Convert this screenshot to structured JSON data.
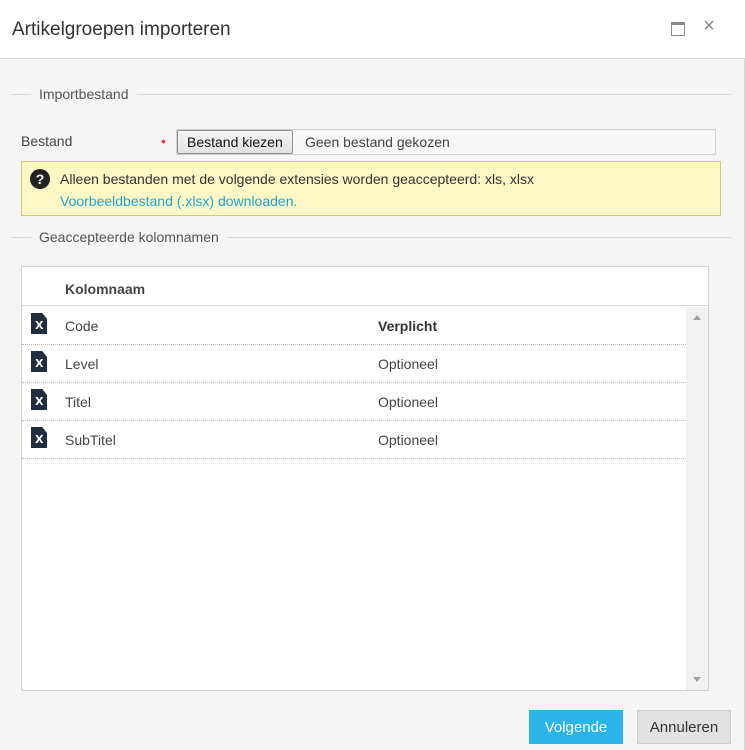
{
  "dialog": {
    "title": "Artikelgroepen importeren",
    "maximize_icon": "maximize-icon",
    "close_label": "×"
  },
  "import_section": {
    "legend": "Importbestand",
    "field_label": "Bestand",
    "required_marker": "•",
    "choose_button": "Bestand kiezen",
    "file_status": "Geen bestand gekozen"
  },
  "info": {
    "icon": "question-circle-icon",
    "icon_glyph": "?",
    "message": "Alleen bestanden met de volgende extensies worden geaccepteerd: xls, xlsx",
    "link": "Voorbeeldbestand (.xlsx) downloaden."
  },
  "columns_section": {
    "legend": "Geaccepteerde kolomnamen",
    "header": "Kolomnaam",
    "rows": [
      {
        "icon": "excel-file-icon",
        "name": "Code",
        "status": "Verplicht"
      },
      {
        "icon": "excel-file-icon",
        "name": "Level",
        "status": "Optioneel"
      },
      {
        "icon": "excel-file-icon",
        "name": "Titel",
        "status": "Optioneel"
      },
      {
        "icon": "excel-file-icon",
        "name": "SubTitel",
        "status": "Optioneel"
      }
    ]
  },
  "footer": {
    "next_button": "Volgende",
    "cancel_button": "Annuleren"
  },
  "colors": {
    "primary": "#2cb3e8",
    "link": "#1ea5d8",
    "info_background": "#fcf8c6",
    "required": "#e53935"
  }
}
